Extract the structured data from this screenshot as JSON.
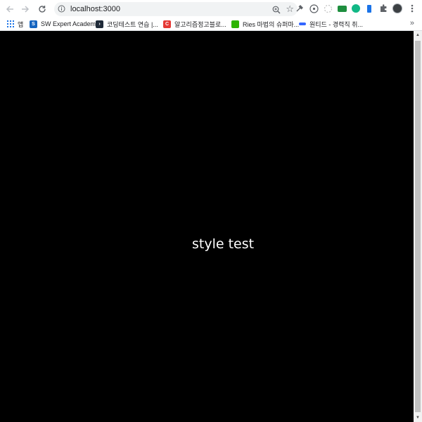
{
  "toolbar": {
    "url": "localhost:3000"
  },
  "bookmarks": {
    "items": [
      {
        "label": "앱",
        "icon": "apps-grid-icon"
      },
      {
        "label": "SW Expert Academy",
        "icon": "swea-icon",
        "color": "#1565c0"
      },
      {
        "label": "코딩테스트 연습 |...",
        "icon": "programmers-icon",
        "color": "#1f2a38"
      },
      {
        "label": "알고리즘정고블로...",
        "icon": "c-logo-icon",
        "color": "#e53935"
      },
      {
        "label": "Ries 마법의 슈퍼마...",
        "icon": "ries-icon",
        "color": "#2db400"
      },
      {
        "label": "원티드 - 경력직 취...",
        "icon": "wanted-icon",
        "color": "#3366ff"
      }
    ],
    "more_label": "»"
  },
  "page": {
    "text": "style test",
    "background": "#000000",
    "text_color": "#ffffff"
  }
}
